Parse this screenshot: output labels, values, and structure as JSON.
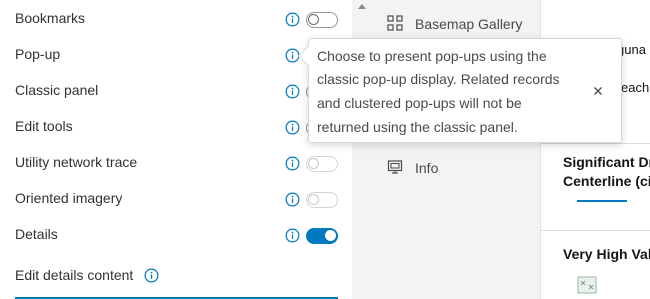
{
  "settings": {
    "rows": [
      {
        "label": "Bookmarks",
        "state": "off"
      },
      {
        "label": "Pop-up",
        "state": "off"
      },
      {
        "label": "Classic panel",
        "state": "off"
      },
      {
        "label": "Edit tools",
        "state": "off"
      },
      {
        "label": "Utility network trace",
        "state": "disabled"
      },
      {
        "label": "Oriented imagery",
        "state": "disabled"
      },
      {
        "label": "Details",
        "state": "on"
      }
    ],
    "edit_details_label": "Edit details content"
  },
  "nav": {
    "items": [
      {
        "label": "Basemap Gallery",
        "icon": "grid-icon"
      },
      {
        "label": "Info",
        "icon": "info-panel-icon"
      }
    ]
  },
  "content": {
    "fragment_top": "guna",
    "fragment_beach": "each",
    "item1_line1": "Significant Dr",
    "item1_line2": "Centerline (cit",
    "item2": "Very High Val"
  },
  "tooltip": {
    "lines": [
      "Choose to present pop-ups using the",
      "classic pop-up display. Related records",
      "and clustered pop-ups will not be",
      "returned using the classic panel."
    ],
    "close_icon": "close-icon"
  },
  "colors": {
    "accent": "#0079c1",
    "panel_bg": "#f3f3f3",
    "text": "#323232"
  }
}
